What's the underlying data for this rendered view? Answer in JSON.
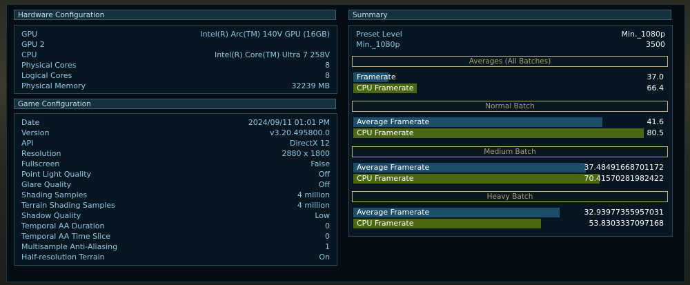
{
  "hardware": {
    "title": "Hardware Configuration",
    "rows": [
      {
        "k": "GPU",
        "v": "Intel(R) Arc(TM) 140V GPU (16GB)"
      },
      {
        "k": "GPU 2",
        "v": ""
      },
      {
        "k": "CPU",
        "v": "Intel(R) Core(TM) Ultra 7 258V"
      },
      {
        "k": "Physical Cores",
        "v": "8"
      },
      {
        "k": "Logical Cores",
        "v": "8"
      },
      {
        "k": "Physical Memory",
        "v": "32239 MB"
      }
    ]
  },
  "game": {
    "title": "Game Configuration",
    "rows": [
      {
        "k": "Date",
        "v": "2024/09/11 01:01 PM"
      },
      {
        "k": "Version",
        "v": "v3.20.495800.0"
      },
      {
        "k": "API",
        "v": "DirectX 12"
      },
      {
        "k": "Resolution",
        "v": "2880 x 1800"
      },
      {
        "k": "Fullscreen",
        "v": "False"
      },
      {
        "k": "Point Light Quality",
        "v": "Off"
      },
      {
        "k": "Glare Quality",
        "v": "Off"
      },
      {
        "k": "Shading Samples",
        "v": "4 million"
      },
      {
        "k": "Terrain Shading Samples",
        "v": "4 million"
      },
      {
        "k": "Shadow Quality",
        "v": "Low"
      },
      {
        "k": "Temporal AA Duration",
        "v": "0"
      },
      {
        "k": "Temporal AA Time Slice",
        "v": "0"
      },
      {
        "k": "Multisample Anti-Aliasing",
        "v": "1"
      },
      {
        "k": "Half-resolution Terrain",
        "v": "On"
      }
    ]
  },
  "summary": {
    "title": "Summary",
    "rows": [
      {
        "k": "Preset Level",
        "v": "Min._1080p"
      },
      {
        "k": "Min._1080p",
        "v": "3500"
      }
    ],
    "sections": [
      {
        "title": "Averages (All Batches)",
        "bars": [
          {
            "label": "Framerate",
            "value": "37.0",
            "fill": 0.115,
            "color": "blue"
          },
          {
            "label": "CPU Framerate",
            "value": "66.4",
            "fill": 0.206,
            "color": "green"
          }
        ]
      },
      {
        "title": "Normal Batch",
        "bars": [
          {
            "label": "Average Framerate",
            "value": "41.6",
            "fill": 0.81,
            "color": "blue"
          },
          {
            "label": "CPU Framerate",
            "value": "80.5",
            "fill": 0.944,
            "color": "green"
          }
        ]
      },
      {
        "title": "Medium Batch",
        "bars": [
          {
            "label": "Average Framerate",
            "value": "37.48491668701172",
            "fill": 0.755,
            "color": "blue"
          },
          {
            "label": "CPU Framerate",
            "value": "70.41570281982422",
            "fill": 0.8,
            "color": "green"
          }
        ]
      },
      {
        "title": "Heavy Batch",
        "bars": [
          {
            "label": "Average Framerate",
            "value": "32.93977355957031",
            "fill": 0.67,
            "color": "blue"
          },
          {
            "label": "CPU Framerate",
            "value": "53.8303337097168",
            "fill": 0.609,
            "color": "green"
          }
        ]
      }
    ]
  }
}
